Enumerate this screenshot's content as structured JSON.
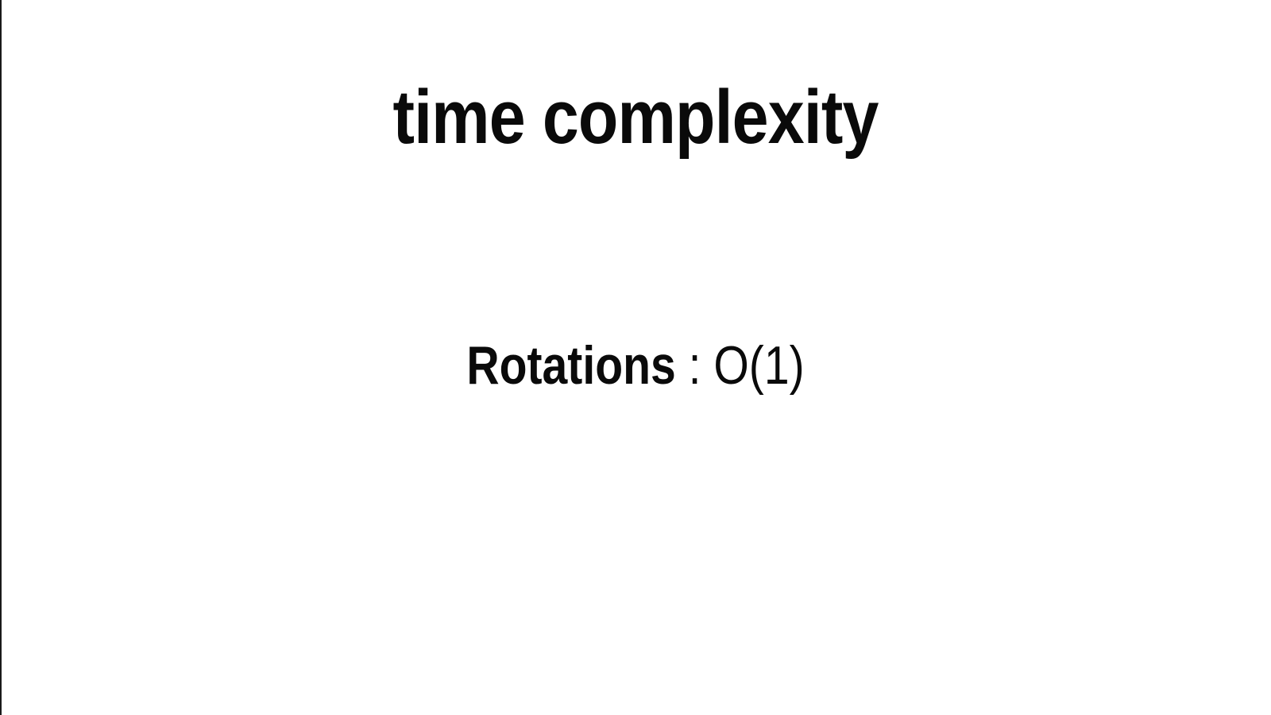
{
  "slide": {
    "title": "time complexity",
    "items": [
      {
        "operation": "Rotations",
        "separator": " : ",
        "complexity": "O(1)"
      }
    ]
  }
}
